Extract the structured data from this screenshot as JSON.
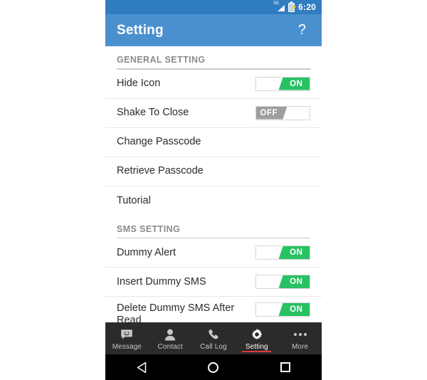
{
  "status_bar": {
    "network_label": "3G",
    "network_icon": "signal-3g-icon",
    "battery_icon": "battery-charging-icon",
    "time": "6:20"
  },
  "app_bar": {
    "title": "Setting",
    "help_label": "?"
  },
  "colors": {
    "status_bar": "#2f7cc0",
    "app_bar": "#4a90cf",
    "toggle_on": "#27c263",
    "toggle_off": "#9e9e9e",
    "tab_bar": "#2b2b2b",
    "active_accent": "#e03a3a",
    "nav_bar": "#000000"
  },
  "sections": [
    {
      "header": "GENERAL SETTING",
      "rows": [
        {
          "label": "Hide Icon",
          "control": "toggle",
          "state": "ON"
        },
        {
          "label": "Shake To Close",
          "control": "toggle",
          "state": "OFF"
        },
        {
          "label": "Change Passcode",
          "control": "none"
        },
        {
          "label": "Retrieve Passcode",
          "control": "none"
        },
        {
          "label": "Tutorial",
          "control": "none"
        }
      ]
    },
    {
      "header": "SMS SETTING",
      "rows": [
        {
          "label": "Dummy Alert",
          "control": "toggle",
          "state": "ON"
        },
        {
          "label": "Insert Dummy SMS",
          "control": "toggle",
          "state": "ON"
        },
        {
          "label": "Delete Dummy SMS After Read",
          "control": "toggle",
          "state": "ON"
        }
      ]
    }
  ],
  "tab_bar": {
    "items": [
      {
        "label": "Message",
        "icon": "message-bubble-icon",
        "active": false
      },
      {
        "label": "Contact",
        "icon": "person-icon",
        "active": false
      },
      {
        "label": "Call Log",
        "icon": "phone-icon",
        "active": false
      },
      {
        "label": "Setting",
        "icon": "gear-icon",
        "active": true
      },
      {
        "label": "More",
        "icon": "ellipsis-icon",
        "active": false
      }
    ]
  },
  "nav_bar": {
    "back": "back-triangle-icon",
    "home": "home-circle-icon",
    "recents": "recents-square-icon"
  }
}
